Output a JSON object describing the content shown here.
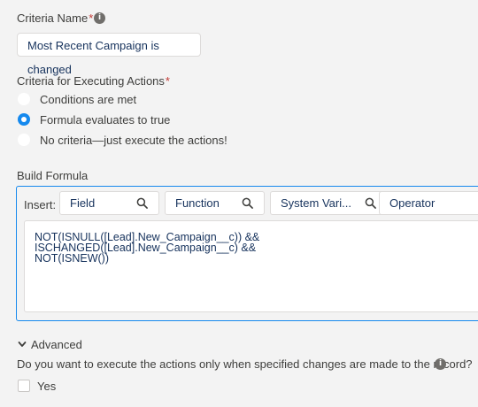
{
  "criteria_name": {
    "label": "Criteria Name",
    "required_mark": "*",
    "info_icon": "info-icon",
    "value": "Most Recent Campaign is changed"
  },
  "executing": {
    "label": "Criteria for Executing Actions",
    "required_mark": "*",
    "options": [
      {
        "label": "Conditions are met",
        "selected": false
      },
      {
        "label": "Formula evaluates to true",
        "selected": true
      },
      {
        "label": "No criteria—just execute the actions!",
        "selected": false
      }
    ]
  },
  "build_formula": {
    "label": "Build Formula",
    "insert_label": "Insert:",
    "pickers": [
      {
        "label": "Field",
        "icon": "search-icon"
      },
      {
        "label": "Function",
        "icon": "search-icon"
      },
      {
        "label": "System Vari...",
        "icon": "search-icon"
      },
      {
        "label": "Operator"
      }
    ],
    "formula_lines": [
      "NOT(ISNULL([Lead].New_Campaign__c)) &&",
      "ISCHANGED([Lead].New_Campaign__c) &&",
      "NOT(ISNEW())"
    ]
  },
  "advanced": {
    "toggle_label": "Advanced",
    "icon": "chevron-down-icon",
    "question": "Do you want to execute the actions only when specified changes are made to the record?",
    "info_icon": "info-icon",
    "checkbox_label": "Yes",
    "checked": false
  },
  "colors": {
    "accent": "#1589ee",
    "text": "#3e3e3c",
    "required": "#c23934",
    "background": "#f3f3f3"
  }
}
